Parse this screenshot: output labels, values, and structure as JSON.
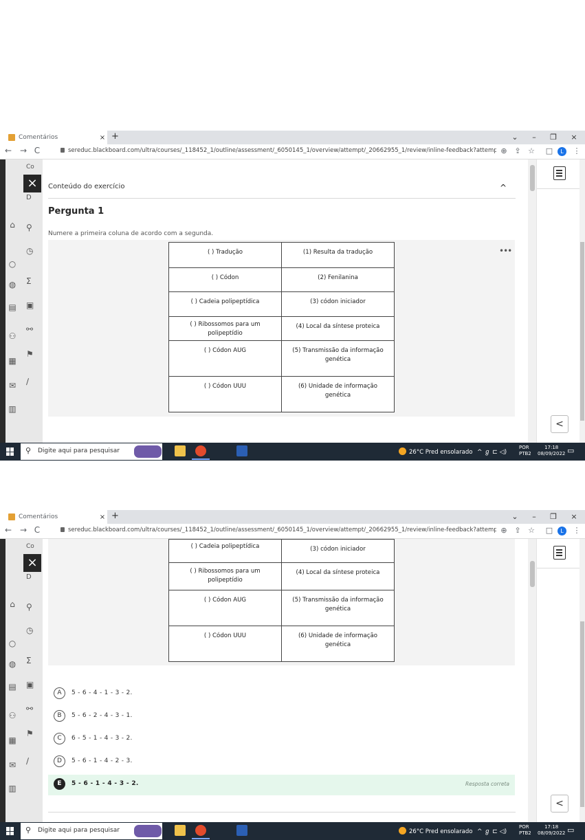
{
  "browser": {
    "tab_title": "Comentários",
    "tab_close": "×",
    "new_tab": "+",
    "url": "sereduc.blackboard.com/ultra/courses/_118452_1/outline/assessment/_6050145_1/overview/attempt/_20662955_1/review/inline-feedback?attemptId=_20662955_...",
    "nav": {
      "back": "←",
      "forward": "→",
      "reload": "C"
    },
    "window": {
      "chevron": "⌄",
      "minimize": "–",
      "restore": "❐",
      "close": "×"
    },
    "toolbar": {
      "zoom": "⊕",
      "share": "⇪",
      "star": "☆",
      "panel": "□",
      "profile": "L",
      "menu": "⋮"
    }
  },
  "panel": {
    "close": "×",
    "collapse": "<",
    "nav_label_1": "Co",
    "nav_label_2": "D"
  },
  "exercise": {
    "section_title": "Conteúdo do exercício",
    "collapse_chevron": "^",
    "question_title": "Pergunta 1",
    "prompt": "Numere a primeira coluna de acordo com a segunda.",
    "more": "•••",
    "table": [
      {
        "left": "( ) Tradução",
        "right": "(1)     Resulta da tradução"
      },
      {
        "left": "( ) Códon",
        "right": "(2)     Fenilanina"
      },
      {
        "left": "( ) Cadeia polipeptídica",
        "right": "(3) códon iniciador"
      },
      {
        "left": "( ) Ribossomos para um polipeptídio",
        "right": "(4) Local da síntese proteica"
      },
      {
        "left": "( ) Códon AUG",
        "right": "(5) Transmissão da informação genética"
      },
      {
        "left": "( )  Códon UUU",
        "right": "(6) Unidade de informação genética"
      }
    ],
    "options": [
      {
        "letter": "A",
        "text": "5 - 6 - 4 - 1 - 3 - 2."
      },
      {
        "letter": "B",
        "text": "5 - 6 - 2 - 4 - 3 - 1."
      },
      {
        "letter": "C",
        "text": "6 - 5 - 1 - 4 - 3 - 2."
      },
      {
        "letter": "D",
        "text": "5 - 6 - 1 - 4 - 2 - 3."
      },
      {
        "letter": "E",
        "text": "5 - 6 - 1 - 4 - 3 - 2."
      }
    ],
    "correct_label": "Resposta correta"
  },
  "taskbar": {
    "search_placeholder": "Digite aqui para pesquisar",
    "search_icon": "⚲",
    "weather": "26°C  Pred ensolarado",
    "tray": "^  ℊ  ⊏  ◁)",
    "lang_1": "POR",
    "lang_2": "PTB2",
    "time": "17:18",
    "date": "08/09/2022",
    "notification": "▭"
  },
  "colors": {
    "correct_bg": "#e5f7ec",
    "taskbar_bg": "#1f2a36",
    "profile_blue": "#1a73e8"
  }
}
